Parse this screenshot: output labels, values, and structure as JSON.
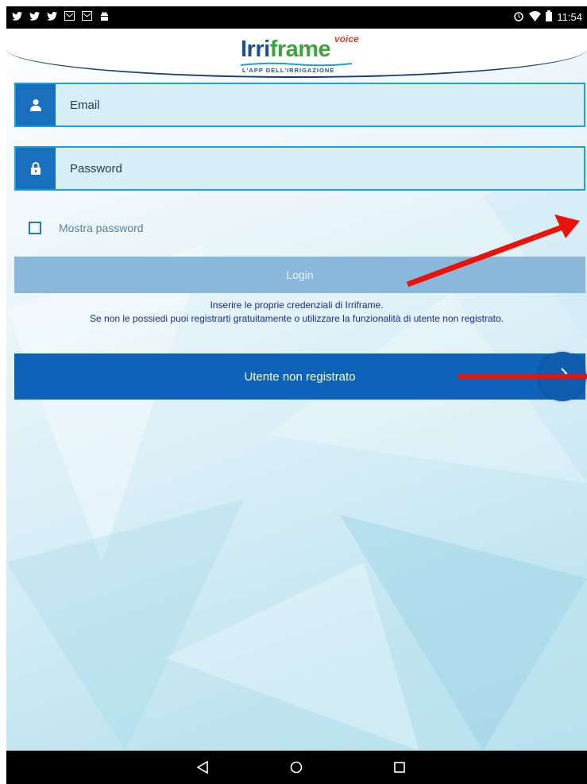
{
  "status_bar": {
    "left_icons": [
      "twitter-icon",
      "twitter-icon",
      "twitter-icon",
      "mail-icon",
      "mail-icon",
      "android-icon"
    ],
    "right_icons": [
      "alarm-icon",
      "wifi-icon",
      "battery-icon"
    ],
    "time": "11:54"
  },
  "header": {
    "logo_main_blue": "Irri",
    "logo_main_green": "frame",
    "logo_voice": "voice",
    "logo_tagline": "L'APP DELL'IRRIGAZIONE"
  },
  "form": {
    "email_placeholder": "Email",
    "email_icon": "user-icon",
    "password_placeholder": "Password",
    "password_icon": "lock-icon",
    "show_password_label": "Mostra password",
    "show_password_checked": false,
    "login_label": "Login"
  },
  "info": {
    "line1": "Inserire le proprie credenziali di Irriframe.",
    "line2": "Se non le possiedi puoi registrarti gratuitamente o utilizzare la funzionalità di utente non registrato."
  },
  "guest": {
    "label": "Utente non registrato",
    "chevron_icon": "chevron-right-icon"
  },
  "nav_bar": {
    "buttons": [
      "back-icon",
      "home-icon",
      "recents-icon"
    ]
  },
  "colors": {
    "accent_blue": "#0e63b8",
    "field_border": "#1a9fd6",
    "login_disabled": "#8ab8da",
    "annotation_arrow": "#e8140c",
    "info_text": "#1b2a9a"
  }
}
